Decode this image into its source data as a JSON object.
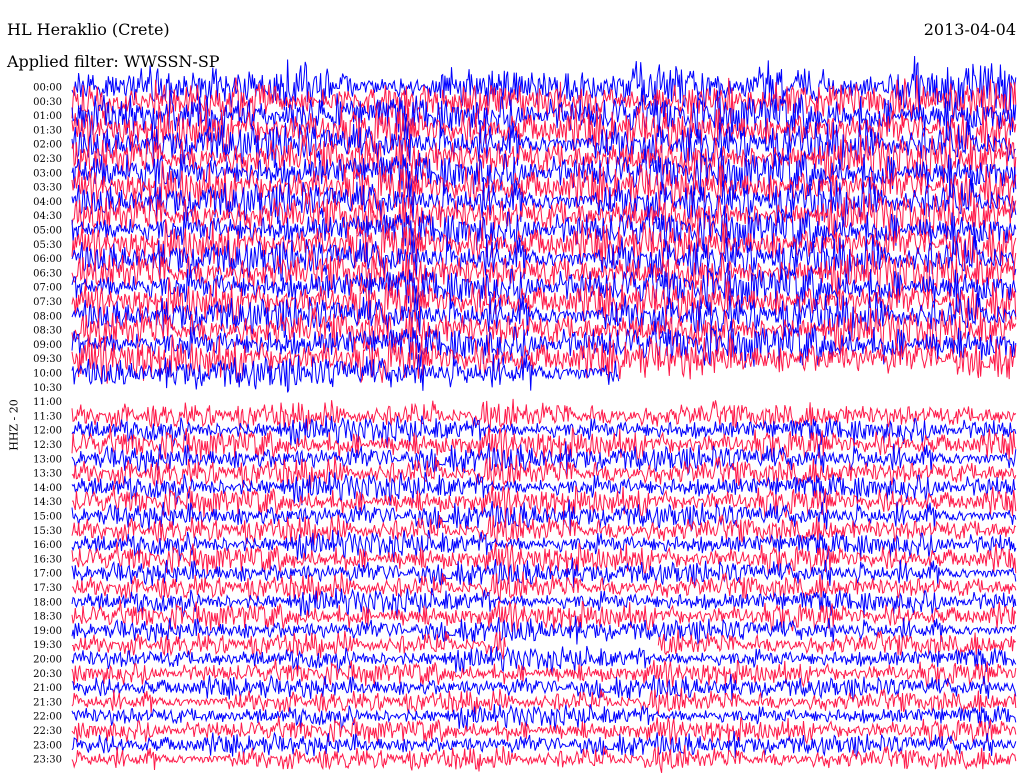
{
  "header": {
    "station": "HL Heraklio (Crete)",
    "date": "2013-04-04",
    "filter": "Applied filter: WWSSN-SP",
    "channel": "HHZ - 20"
  },
  "chart_data": {
    "type": "line",
    "title": "HL Heraklio (Crete)",
    "subtitle": "Applied filter: WWSSN-SP",
    "ylabel": "HHZ - 20",
    "colors": [
      "#0000ff",
      "#ff1a4a"
    ],
    "row_labels": [
      "00:00",
      "00:30",
      "01:00",
      "01:30",
      "02:00",
      "02:30",
      "03:00",
      "03:30",
      "04:00",
      "04:30",
      "05:00",
      "05:30",
      "06:00",
      "06:30",
      "07:00",
      "07:30",
      "08:00",
      "08:30",
      "09:00",
      "09:30",
      "10:00",
      "10:30",
      "11:00",
      "11:30",
      "12:00",
      "12:30",
      "13:00",
      "13:30",
      "14:00",
      "14:30",
      "15:00",
      "15:30",
      "16:00",
      "16:30",
      "17:00",
      "17:30",
      "18:00",
      "18:30",
      "19:00",
      "19:30",
      "20:00",
      "20:30",
      "21:00",
      "21:30",
      "22:00",
      "22:30",
      "23:00",
      "23:30"
    ],
    "amplitude_level": [
      1.0,
      1.0,
      1.0,
      1.0,
      1.0,
      1.0,
      1.0,
      1.0,
      0.95,
      0.95,
      0.95,
      0.95,
      0.95,
      0.95,
      0.95,
      0.9,
      0.9,
      0.9,
      0.9,
      0.9,
      0.75,
      0.0,
      0.0,
      0.45,
      0.45,
      0.5,
      0.5,
      0.5,
      0.5,
      0.45,
      0.45,
      0.45,
      0.45,
      0.45,
      0.4,
      0.4,
      0.4,
      0.4,
      0.35,
      0.35,
      0.35,
      0.3,
      0.3,
      0.3,
      0.3,
      0.3,
      0.3,
      0.3
    ],
    "gaps": [
      {
        "row": "10:00",
        "from_fraction": 0.58,
        "to_fraction": 1.0
      },
      {
        "row": "10:30",
        "from_fraction": 0.0,
        "to_fraction": 1.0
      },
      {
        "row": "11:00",
        "from_fraction": 0.0,
        "to_fraction": 0.85
      },
      {
        "row": "19:30",
        "from_fraction": 0.46,
        "to_fraction": 0.62
      }
    ]
  }
}
